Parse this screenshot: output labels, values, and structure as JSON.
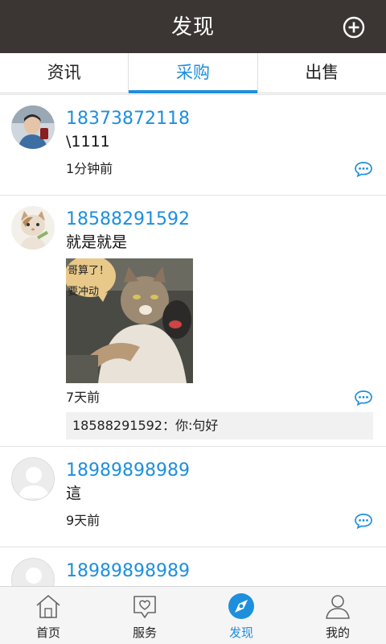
{
  "header": {
    "title": "发现",
    "add_icon": "plus-circle-icon"
  },
  "tabs": [
    {
      "label": "资讯",
      "active": false
    },
    {
      "label": "采购",
      "active": true
    },
    {
      "label": "出售",
      "active": false
    }
  ],
  "accent_color": "#1e8fdd",
  "header_color": "#3b3634",
  "posts": [
    {
      "author": "18373872118",
      "text": "\\1111",
      "time": "1分钟前",
      "avatar": "photo-avatar"
    },
    {
      "author": "18588291592",
      "text": "就是就是",
      "time": "7天前",
      "avatar": "cat-avatar",
      "image_caption": [
        "哥算了！",
        "要冲动"
      ],
      "reply": "18588291592：你:句好"
    },
    {
      "author": "18989898989",
      "text": "這",
      "time": "9天前",
      "avatar": "default-avatar"
    },
    {
      "author": "18989898989",
      "text": "",
      "time": "",
      "avatar": "default-avatar"
    }
  ],
  "bottom_nav": [
    {
      "label": "首页",
      "icon": "home-icon",
      "active": false
    },
    {
      "label": "服务",
      "icon": "heart-bubble-icon",
      "active": false
    },
    {
      "label": "发现",
      "icon": "compass-icon",
      "active": true
    },
    {
      "label": "我的",
      "icon": "person-icon",
      "active": false
    }
  ]
}
